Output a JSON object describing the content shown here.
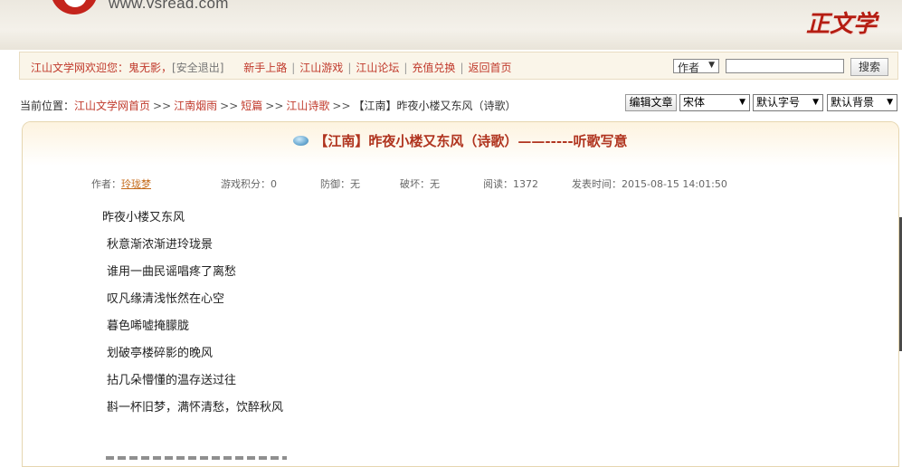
{
  "banner": {
    "site_url": "www.vsread.com",
    "brand": "正文学",
    "accent": "#c4241c"
  },
  "topnav": {
    "welcome": "江山文学网欢迎您：",
    "username": "鬼无影，",
    "logout": "[安全退出]",
    "links": [
      "新手上路",
      "江山游戏",
      "江山论坛",
      "充值兑换",
      "返回首页"
    ],
    "separator": "|",
    "search_field": "作者",
    "search_value": "",
    "search_button": "搜索"
  },
  "breadcrumb": {
    "prefix": "当前位置：",
    "items": [
      "江山文学网首页",
      "江南烟雨",
      "短篇",
      "江山诗歌"
    ],
    "arrow": ">>",
    "current": "【江南】昨夜小楼又东风（诗歌）"
  },
  "toolbar": {
    "edit": "编辑文章",
    "font": "宋体",
    "size": "默认字号",
    "background": "默认背景"
  },
  "article": {
    "title": "【江南】昨夜小楼又东风（诗歌）——-----听歌写意",
    "author_label": "作者：",
    "author": "玲珑梦",
    "game_points": "游戏积分：0",
    "defense": "防御：无",
    "destroy": "破坏：无",
    "reads": "阅读：1372",
    "published": "发表时间：2015-08-15 14:01:50",
    "lines": [
      "昨夜小楼又东风",
      " 秋意渐浓渐进玲珑景",
      " 谁用一曲民谣唱疼了离愁",
      " 叹凡缘清浅怅然在心空",
      " 暮色唏嘘掩朦胧",
      " 划破亭楼碎影的晚风",
      " 拈几朵懵懂的温存送过往",
      " 斟一杯旧梦，满怀清愁，饮醉秋风"
    ]
  },
  "colors": {
    "link_red": "#c0392b",
    "title_red": "#b0341f",
    "nav_bg": "#faf5e9"
  }
}
